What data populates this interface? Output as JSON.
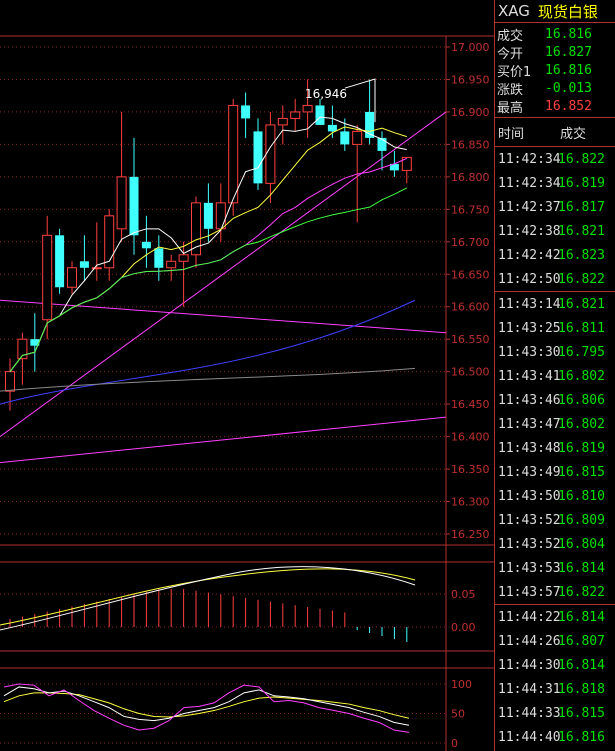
{
  "header": {
    "symbol": "XAG",
    "name": "现货白银"
  },
  "quotes": [
    {
      "label": "成交",
      "value": "16.816",
      "color": "#00e000"
    },
    {
      "label": "今开",
      "value": "16.827",
      "color": "#00e000"
    },
    {
      "label": "买价1",
      "value": "16.816",
      "color": "#00e000"
    },
    {
      "label": "涨跌",
      "value": "-0.013",
      "color": "#00e000"
    },
    {
      "label": "最高",
      "value": "16.852",
      "color": "#ff4040"
    }
  ],
  "ticks_header": {
    "time": "时间",
    "price": "成交"
  },
  "ticks": [
    {
      "time": "11:42:34",
      "price": "16.822"
    },
    {
      "time": "11:42:34",
      "price": "16.819"
    },
    {
      "time": "11:42:37",
      "price": "16.817"
    },
    {
      "time": "11:42:38",
      "price": "16.821"
    },
    {
      "time": "11:42:42",
      "price": "16.823"
    },
    {
      "time": "11:42:50",
      "price": "16.822"
    },
    {
      "time": "11:43:14",
      "price": "16.821"
    },
    {
      "time": "11:43:25",
      "price": "16.811"
    },
    {
      "time": "11:43:30",
      "price": "16.795"
    },
    {
      "time": "11:43:41",
      "price": "16.802"
    },
    {
      "time": "11:43:46",
      "price": "16.806"
    },
    {
      "time": "11:43:47",
      "price": "16.802"
    },
    {
      "time": "11:43:48",
      "price": "16.819"
    },
    {
      "time": "11:43:49",
      "price": "16.815"
    },
    {
      "time": "11:43:50",
      "price": "16.810"
    },
    {
      "time": "11:43:52",
      "price": "16.809"
    },
    {
      "time": "11:43:52",
      "price": "16.804"
    },
    {
      "time": "11:43:53",
      "price": "16.814"
    },
    {
      "time": "11:43:57",
      "price": "16.822"
    },
    {
      "time": "11:44:22",
      "price": "16.814"
    },
    {
      "time": "11:44:26",
      "price": "16.807"
    },
    {
      "time": "11:44:30",
      "price": "16.814"
    },
    {
      "time": "11:44:31",
      "price": "16.818"
    },
    {
      "time": "11:44:33",
      "price": "16.815"
    },
    {
      "time": "11:44:40",
      "price": "16.816"
    }
  ],
  "chart_data": {
    "type": "candlestick",
    "price_axis": {
      "ticks": [
        "17.000",
        "16.950",
        "16.900",
        "16.850",
        "16.800",
        "16.750",
        "16.700",
        "16.650",
        "16.600",
        "16.550",
        "16.500",
        "16.450",
        "16.400",
        "16.350",
        "16.300",
        "16.250"
      ],
      "range": [
        16.25,
        17.0
      ]
    },
    "annotation": {
      "label": "16,946",
      "value": 16.946
    },
    "candles": [
      {
        "o": 16.47,
        "h": 16.52,
        "l": 16.44,
        "c": 16.5
      },
      {
        "o": 16.52,
        "h": 16.56,
        "l": 16.48,
        "c": 16.55
      },
      {
        "o": 16.55,
        "h": 16.59,
        "l": 16.5,
        "c": 16.54
      },
      {
        "o": 16.58,
        "h": 16.74,
        "l": 16.55,
        "c": 16.71
      },
      {
        "o": 16.71,
        "h": 16.72,
        "l": 16.62,
        "c": 16.63
      },
      {
        "o": 16.63,
        "h": 16.67,
        "l": 16.62,
        "c": 16.66
      },
      {
        "o": 16.67,
        "h": 16.71,
        "l": 16.64,
        "c": 16.66
      },
      {
        "o": 16.66,
        "h": 16.73,
        "l": 16.64,
        "c": 16.66
      },
      {
        "o": 16.66,
        "h": 16.75,
        "l": 16.64,
        "c": 16.74
      },
      {
        "o": 16.72,
        "h": 16.9,
        "l": 16.7,
        "c": 16.8
      },
      {
        "o": 16.8,
        "h": 16.86,
        "l": 16.68,
        "c": 16.71
      },
      {
        "o": 16.7,
        "h": 16.74,
        "l": 16.66,
        "c": 16.69
      },
      {
        "o": 16.69,
        "h": 16.71,
        "l": 16.64,
        "c": 16.66
      },
      {
        "o": 16.66,
        "h": 16.68,
        "l": 16.64,
        "c": 16.67
      },
      {
        "o": 16.67,
        "h": 16.7,
        "l": 16.6,
        "c": 16.68
      },
      {
        "o": 16.68,
        "h": 16.77,
        "l": 16.66,
        "c": 16.76
      },
      {
        "o": 16.76,
        "h": 16.79,
        "l": 16.7,
        "c": 16.72
      },
      {
        "o": 16.72,
        "h": 16.79,
        "l": 16.7,
        "c": 16.76
      },
      {
        "o": 16.76,
        "h": 16.92,
        "l": 16.74,
        "c": 16.91
      },
      {
        "o": 16.91,
        "h": 16.93,
        "l": 16.86,
        "c": 16.89
      },
      {
        "o": 16.87,
        "h": 16.89,
        "l": 16.78,
        "c": 16.79
      },
      {
        "o": 16.79,
        "h": 16.9,
        "l": 16.76,
        "c": 16.88
      },
      {
        "o": 16.88,
        "h": 16.91,
        "l": 16.85,
        "c": 16.89
      },
      {
        "o": 16.89,
        "h": 16.92,
        "l": 16.87,
        "c": 16.9
      },
      {
        "o": 16.9,
        "h": 16.95,
        "l": 16.86,
        "c": 16.91
      },
      {
        "o": 16.91,
        "h": 16.92,
        "l": 16.88,
        "c": 16.88
      },
      {
        "o": 16.88,
        "h": 16.91,
        "l": 16.86,
        "c": 16.87
      },
      {
        "o": 16.87,
        "h": 16.89,
        "l": 16.84,
        "c": 16.85
      },
      {
        "o": 16.85,
        "h": 16.88,
        "l": 16.73,
        "c": 16.87
      },
      {
        "o": 16.9,
        "h": 16.95,
        "l": 16.85,
        "c": 16.86
      },
      {
        "o": 16.86,
        "h": 16.87,
        "l": 16.81,
        "c": 16.84
      },
      {
        "o": 16.82,
        "h": 16.84,
        "l": 16.8,
        "c": 16.81
      },
      {
        "o": 16.81,
        "h": 16.83,
        "l": 16.79,
        "c": 16.83
      }
    ],
    "macd_axis": {
      "ticks": [
        "0.05",
        "0.00"
      ]
    },
    "kdj_axis": {
      "ticks": [
        "100",
        "50",
        "0"
      ]
    }
  }
}
